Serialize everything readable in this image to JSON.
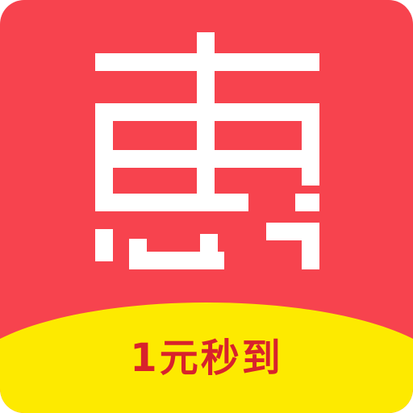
{
  "app_icon": {
    "logo_text": "惠",
    "banner_text": "1元秒到",
    "colors": {
      "background": "#f7434e",
      "glyph": "#ffffff",
      "banner": "#fdea00",
      "banner_text": "#d8222c"
    }
  }
}
